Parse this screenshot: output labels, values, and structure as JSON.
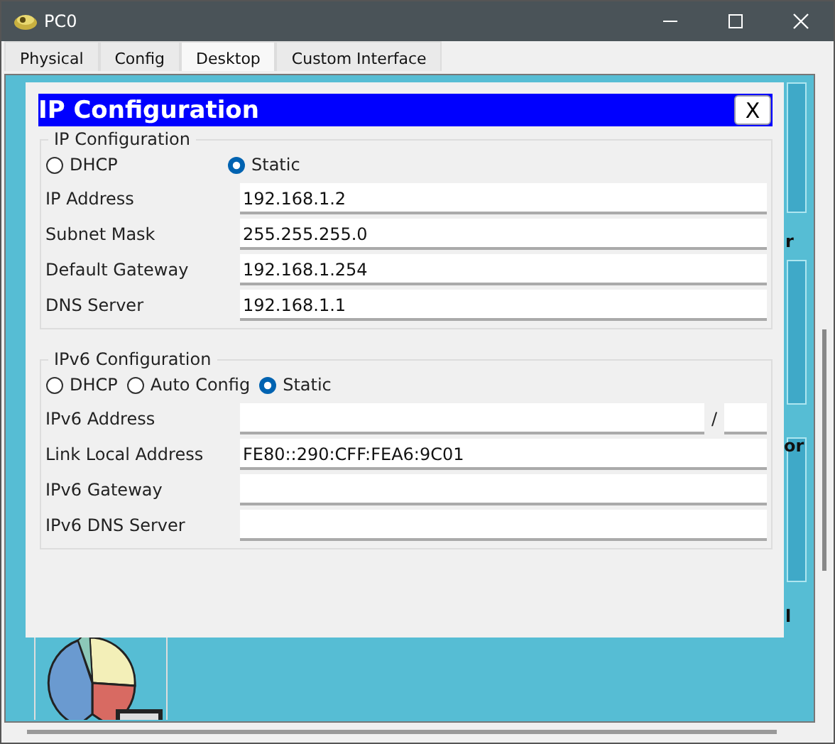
{
  "window": {
    "title": "PC0"
  },
  "tabs": [
    {
      "label": "Physical",
      "selected": false
    },
    {
      "label": "Config",
      "selected": false
    },
    {
      "label": "Desktop",
      "selected": true
    },
    {
      "label": "Custom Interface",
      "selected": false
    }
  ],
  "background_fragments": [
    "r",
    "or",
    "l"
  ],
  "dialog": {
    "title": "IP Configuration",
    "close": "X",
    "ipv4": {
      "legend": "IP Configuration",
      "modes": [
        {
          "label": "DHCP",
          "selected": false
        },
        {
          "label": "Static",
          "selected": true
        }
      ],
      "fields": [
        {
          "kind": "plain",
          "label": "IP Address",
          "value": "192.168.1.2"
        },
        {
          "kind": "plain",
          "label": "Subnet Mask",
          "value": "255.255.255.0"
        },
        {
          "kind": "plain",
          "label": "Default Gateway",
          "value": "192.168.1.254"
        },
        {
          "kind": "plain",
          "label": "DNS Server",
          "value": "192.168.1.1"
        }
      ]
    },
    "ipv6": {
      "legend": "IPv6 Configuration",
      "modes": [
        {
          "label": "DHCP",
          "selected": false
        },
        {
          "label": "Auto Config",
          "selected": false
        },
        {
          "label": "Static",
          "selected": true
        }
      ],
      "fields": [
        {
          "kind": "prefix",
          "label": "IPv6 Address",
          "separator": "/"
        },
        {
          "kind": "plain",
          "label": "Link Local Address",
          "value": "FE80::290:CFF:FEA6:9C01"
        },
        {
          "kind": "plain",
          "label": "IPv6 Gateway"
        },
        {
          "kind": "plain",
          "label": "IPv6 DNS Server"
        }
      ]
    }
  }
}
